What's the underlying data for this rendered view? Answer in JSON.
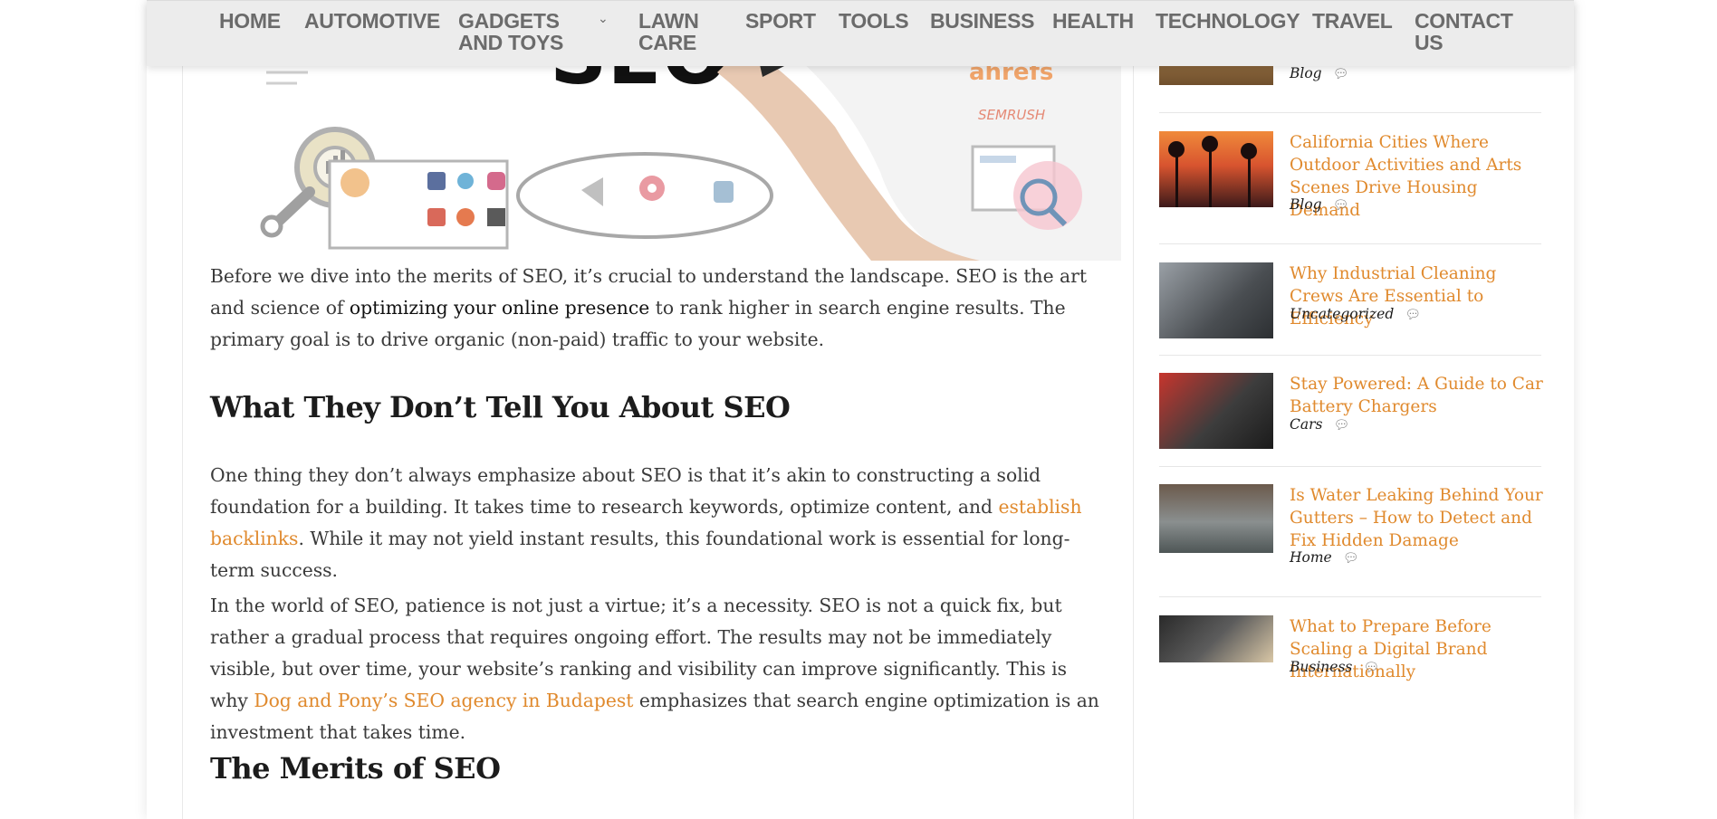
{
  "nav": {
    "items": [
      {
        "label": "HOME"
      },
      {
        "label": "AUTOMOTIVE"
      },
      {
        "label": "GADGETS AND TOYS"
      },
      {
        "label": "LAWN CARE"
      },
      {
        "label": "SPORT"
      },
      {
        "label": "TOOLS"
      },
      {
        "label": "BUSINESS"
      },
      {
        "label": "HEALTH"
      },
      {
        "label": "TECHNOLOGY"
      },
      {
        "label": "TRAVEL"
      },
      {
        "label": "CONTACT US"
      }
    ],
    "dropdown_icon": "chevron-down-icon"
  },
  "hero": {
    "big_text": "SEO",
    "brand_text_1": "ahrefs",
    "brand_text_2": "SEMRUSH"
  },
  "article": {
    "p1_before": "Before we dive into the merits of SEO, it’s crucial to understand the landscape. SEO is the art and science of ",
    "p1_link": "optimizing your online presence",
    "p1_after": " to rank higher in search engine results. The primary goal is to drive organic (non-paid) traffic to your website.",
    "h2_1": "What They Don’t Tell You About SEO",
    "p2_before": "One thing they don’t always emphasize about SEO is that it’s akin to constructing a solid foundation for a building. It takes time to research keywords, optimize content, and ",
    "p2_link": "establish backlinks",
    "p2_after": ". While it may not yield instant results, this foundational work is essential for long-term success.",
    "p3_before": "In the world of SEO, patience is not just a virtue; it’s a necessity. SEO is not a quick fix, but rather a gradual process that requires ongoing effort. The results may not be immediately visible, but over time, your website’s ranking and visibility can improve significantly. This is why ",
    "p3_link": "Dog and Pony’s SEO agency in Budapest",
    "p3_after": " emphasizes that search engine optimization is an investment that takes time.",
    "h2_2": "The Merits of SEO"
  },
  "sidebar": {
    "posts": [
      {
        "title": "",
        "category": "Blog"
      },
      {
        "title": "California Cities Where Outdoor Activities and Arts Scenes Drive Housing Demand",
        "category": "Blog"
      },
      {
        "title": "Why Industrial Cleaning Crews Are Essential to Efficiency",
        "category": "Uncategorized"
      },
      {
        "title": "Stay Powered: A Guide to Car Battery Chargers",
        "category": "Cars"
      },
      {
        "title": "Is Water Leaking Behind Your Gutters – How to Detect and Fix Hidden Damage",
        "category": "Home"
      },
      {
        "title": "What to Prepare Before Scaling a Digital Brand Internationally",
        "category": "Business"
      }
    ],
    "comment_icon": "comment-icon"
  },
  "colors": {
    "accent": "#e08a2e",
    "nav_bg": "#ececec",
    "nav_text": "#6b6b6b",
    "body_text": "#3a3a3a"
  }
}
